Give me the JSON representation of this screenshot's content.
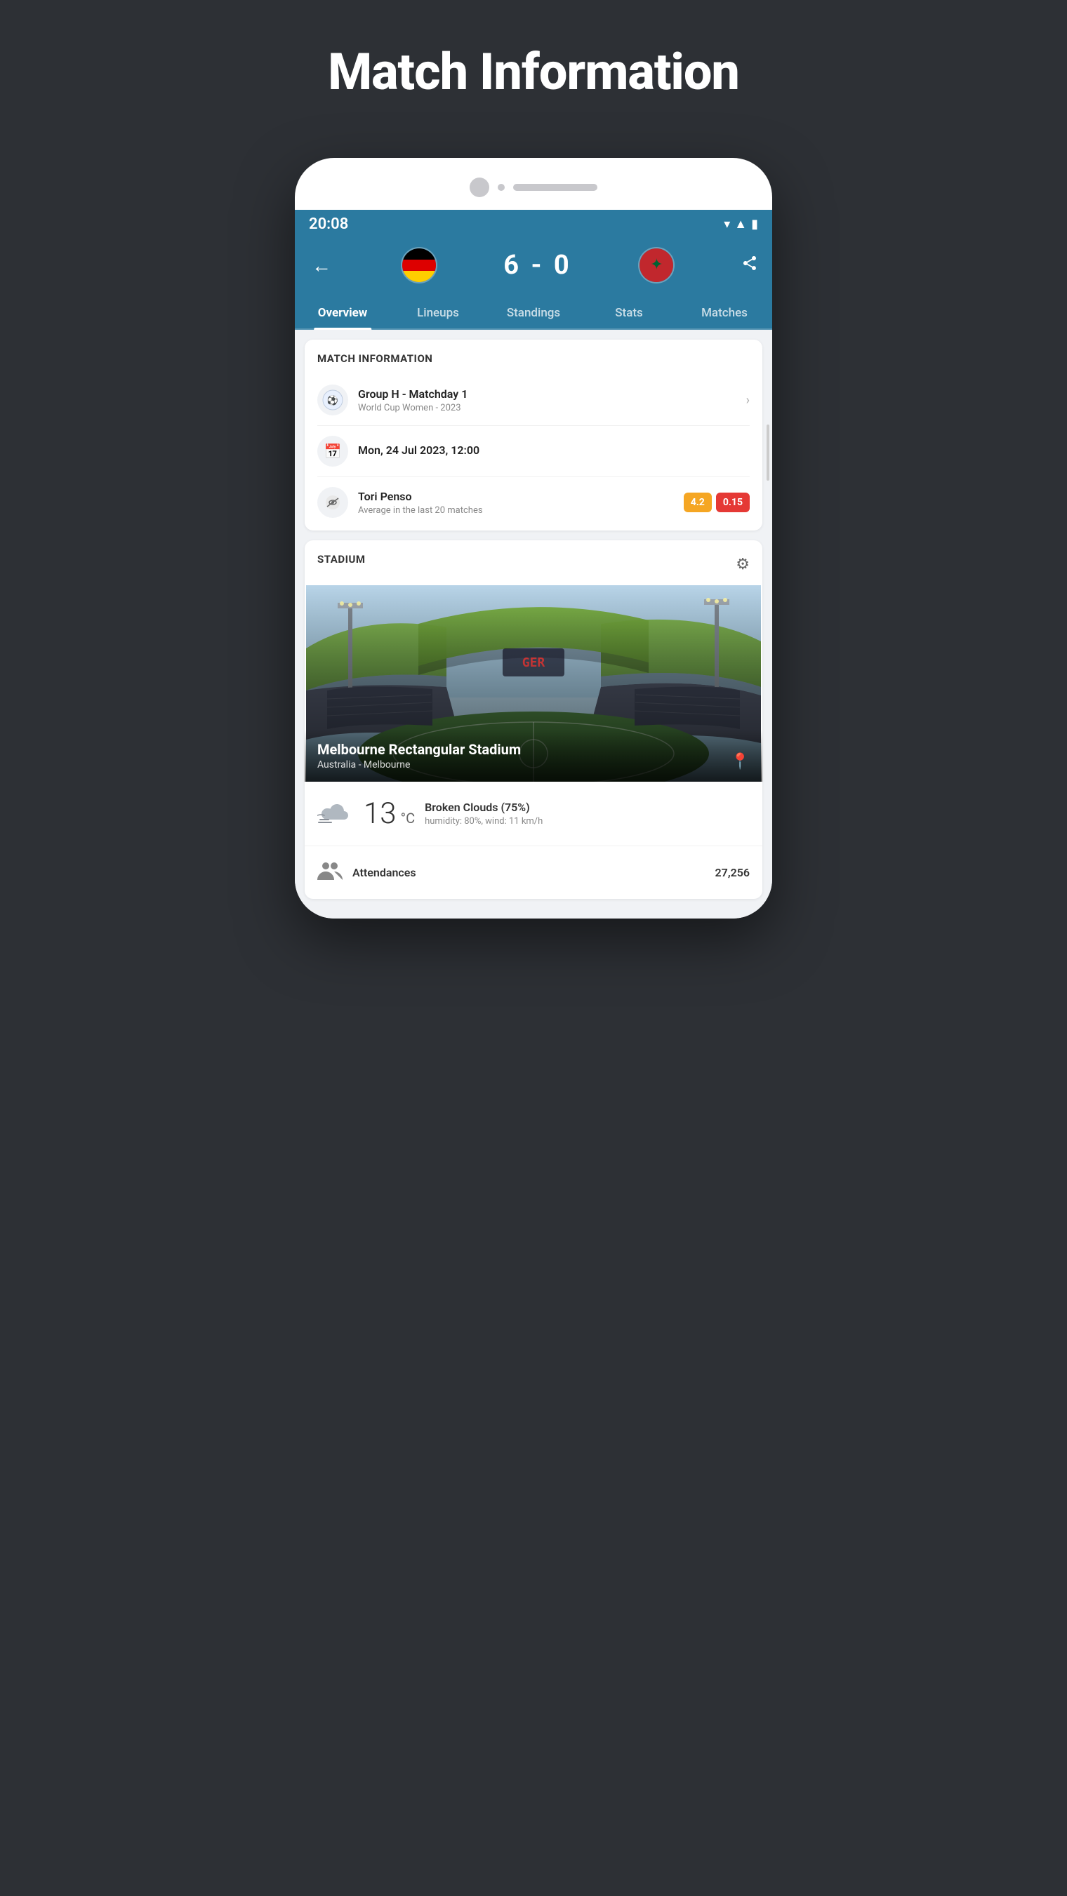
{
  "page": {
    "title": "Match Information",
    "background_color": "#2d3035"
  },
  "status_bar": {
    "time": "20:08"
  },
  "match_header": {
    "score": "6 - 0",
    "team_home": "Germany",
    "team_away": "Morocco",
    "back_label": "←",
    "share_label": "share"
  },
  "nav_tabs": [
    {
      "label": "Overview",
      "active": true
    },
    {
      "label": "Lineups",
      "active": false
    },
    {
      "label": "Standings",
      "active": false
    },
    {
      "label": "Stats",
      "active": false
    },
    {
      "label": "Matches",
      "active": false
    }
  ],
  "match_info_section": {
    "title": "MATCH INFORMATION",
    "competition_name": "Group H - Matchday 1",
    "competition_subtitle": "World Cup Women - 2023",
    "date_label": "Mon, 24 Jul 2023, 12:00",
    "referee_name": "Tori Penso",
    "referee_subtitle": "Average in the last 20 matches",
    "referee_badge_orange": "4.2",
    "referee_badge_red": "0.15"
  },
  "stadium_section": {
    "title": "STADIUM",
    "stadium_name": "Melbourne Rectangular Stadium",
    "stadium_location": "Australia - Melbourne"
  },
  "weather": {
    "temperature": "13",
    "unit": "°C",
    "condition": "Broken Clouds (75%)",
    "details": "humidity: 80%, wind: 11 km/h"
  },
  "attendance": {
    "label": "Attendances",
    "value": "27,256"
  }
}
